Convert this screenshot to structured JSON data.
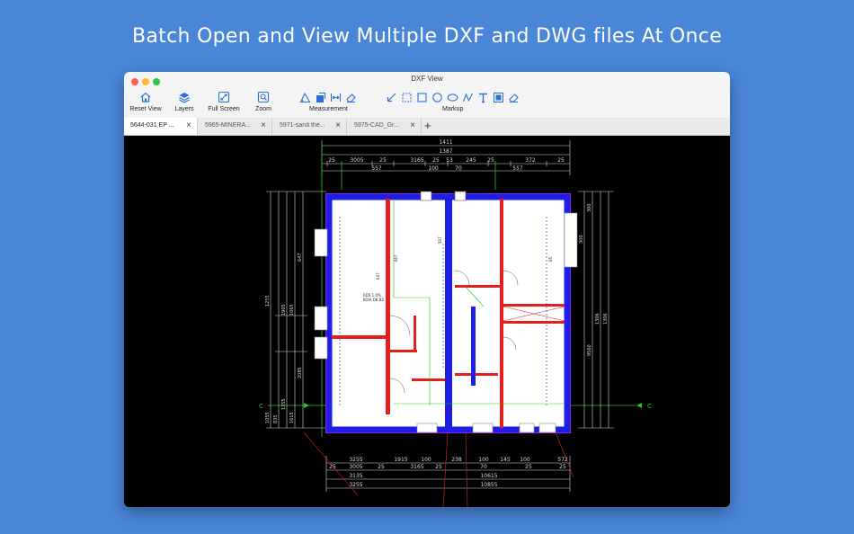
{
  "headline": "Batch Open and View Multiple DXF and DWG files At Once",
  "window": {
    "title": "DXF View"
  },
  "toolbar": {
    "reset_view": "Reset View",
    "layers": "Layers",
    "full_screen": "Full Screen",
    "zoom": "Zoom",
    "measurement": "Measurement",
    "markup": "Markup"
  },
  "tabs": [
    {
      "label": "5644-031 EP ..."
    },
    {
      "label": "5965-MINERA..."
    },
    {
      "label": "5971-sanâ the..."
    },
    {
      "label": "5975-CAD_Gr..."
    }
  ],
  "tab_close_glyph": "×",
  "tab_add_glyph": "+",
  "drawing": {
    "dim_top_overall": "1411",
    "dim_top_row2": "1387",
    "dim_top_row3": [
      "25",
      "3005",
      "25",
      "3165",
      "25",
      "53",
      "245",
      "25",
      "372",
      "25"
    ],
    "dim_top_row4": [
      "557",
      "100",
      "70",
      "557"
    ],
    "dim_bottom_row1": [
      "3255",
      "1915",
      "100",
      "238",
      "100",
      "145",
      "100",
      "572"
    ],
    "dim_bottom_row2": [
      "25",
      "3005",
      "25",
      "3165",
      "25",
      "70",
      "25",
      "25"
    ],
    "dim_bottom_row3": [
      "3135",
      "10615"
    ],
    "dim_bottom_row4": [
      "3255",
      "10855"
    ],
    "dim_left": [
      "1255",
      "1905",
      "1065",
      "647",
      "2085",
      "1355",
      "1055",
      "835",
      "1615"
    ],
    "dim_right": [
      "1306",
      "1306",
      "9560",
      "300",
      "300"
    ],
    "axis_marks": [
      "C",
      "C"
    ],
    "room_labels": [
      "RDS 1.0%",
      "KOIA OK B2",
      "647",
      "667",
      "507",
      "65"
    ],
    "colors": {
      "wall_blue": "#1e1ee6",
      "wall_red": "#e61e1e",
      "dim_lines": "#d9d9d9",
      "green": "#22c722",
      "magenta": "#ff22ff"
    }
  }
}
